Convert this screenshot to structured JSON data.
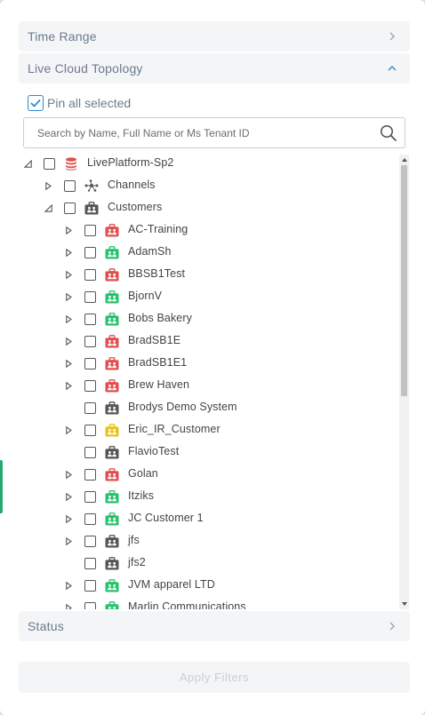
{
  "filters": {
    "time_range": {
      "label": "Time Range",
      "state": "collapsed"
    },
    "topology": {
      "label": "Live Cloud Topology",
      "state": "expanded"
    },
    "status": {
      "label": "Status",
      "state": "collapsed"
    },
    "apply_label": "Apply Filters"
  },
  "pin": {
    "label": "Pin all selected",
    "checked": true
  },
  "search": {
    "placeholder": "Search by Name, Full Name or Ms Tenant ID",
    "value": ""
  },
  "colors": {
    "accent": "#2b8ad6",
    "red": "#e04f4f",
    "green": "#27c26b",
    "yellow": "#e8c21c",
    "dark": "#555555",
    "header_bg": "#f4f5f7",
    "header_text": "#6b7a8f"
  },
  "tree": [
    {
      "label": "LivePlatform-Sp2",
      "level": 0,
      "expander": "expanded",
      "icon": "database-icon",
      "color": "red"
    },
    {
      "label": "Channels",
      "level": 1,
      "expander": "collapsed",
      "icon": "network-icon",
      "color": "dark"
    },
    {
      "label": "Customers",
      "level": 1,
      "expander": "expanded",
      "icon": "briefcase-icon",
      "color": "dark"
    },
    {
      "label": "AC-Training",
      "level": 2,
      "expander": "collapsed",
      "icon": "briefcase-icon",
      "color": "red"
    },
    {
      "label": "AdamSh",
      "level": 2,
      "expander": "collapsed",
      "icon": "briefcase-icon",
      "color": "green"
    },
    {
      "label": "BBSB1Test",
      "level": 2,
      "expander": "collapsed",
      "icon": "briefcase-icon",
      "color": "red"
    },
    {
      "label": "BjornV",
      "level": 2,
      "expander": "collapsed",
      "icon": "briefcase-icon",
      "color": "green"
    },
    {
      "label": "Bobs Bakery",
      "level": 2,
      "expander": "collapsed",
      "icon": "briefcase-icon",
      "color": "green"
    },
    {
      "label": "BradSB1E",
      "level": 2,
      "expander": "collapsed",
      "icon": "briefcase-icon",
      "color": "red"
    },
    {
      "label": "BradSB1E1",
      "level": 2,
      "expander": "collapsed",
      "icon": "briefcase-icon",
      "color": "red"
    },
    {
      "label": "Brew Haven",
      "level": 2,
      "expander": "collapsed",
      "icon": "briefcase-icon",
      "color": "red"
    },
    {
      "label": "Brodys Demo System",
      "level": 2,
      "expander": "none",
      "icon": "briefcase-icon",
      "color": "dark"
    },
    {
      "label": "Eric_IR_Customer",
      "level": 2,
      "expander": "collapsed",
      "icon": "briefcase-icon",
      "color": "yellow"
    },
    {
      "label": "FlavioTest",
      "level": 2,
      "expander": "none",
      "icon": "briefcase-icon",
      "color": "dark"
    },
    {
      "label": "Golan",
      "level": 2,
      "expander": "collapsed",
      "icon": "briefcase-icon",
      "color": "red"
    },
    {
      "label": "Itziks",
      "level": 2,
      "expander": "collapsed",
      "icon": "briefcase-icon",
      "color": "green"
    },
    {
      "label": "JC Customer 1",
      "level": 2,
      "expander": "collapsed",
      "icon": "briefcase-icon",
      "color": "green"
    },
    {
      "label": "jfs",
      "level": 2,
      "expander": "collapsed",
      "icon": "briefcase-icon",
      "color": "dark"
    },
    {
      "label": "jfs2",
      "level": 2,
      "expander": "none",
      "icon": "briefcase-icon",
      "color": "dark"
    },
    {
      "label": "JVM apparel LTD",
      "level": 2,
      "expander": "collapsed",
      "icon": "briefcase-icon",
      "color": "green"
    },
    {
      "label": "Marlin Communications",
      "level": 2,
      "expander": "collapsed",
      "icon": "briefcase-icon",
      "color": "green"
    }
  ]
}
